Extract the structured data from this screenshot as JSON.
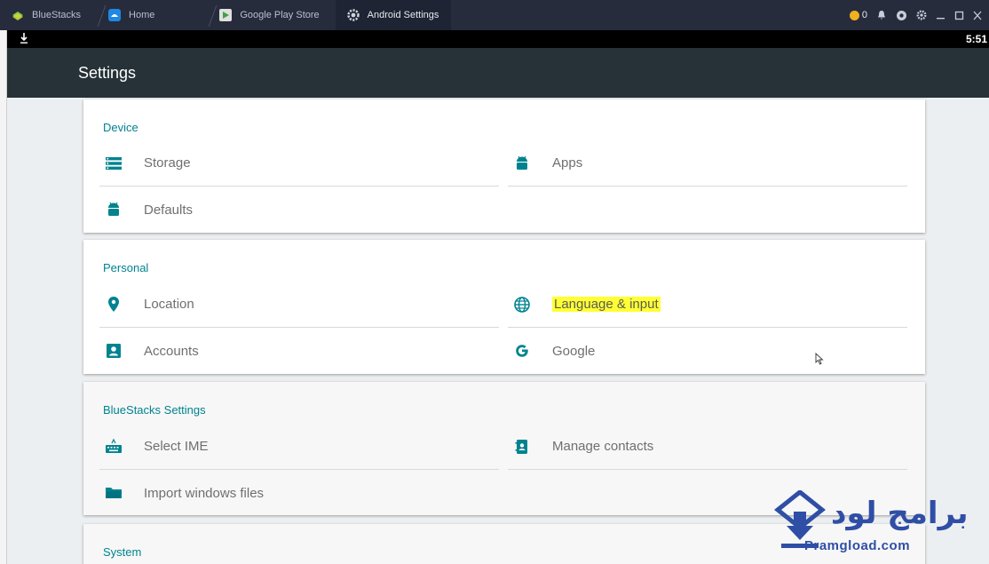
{
  "titlebar": {
    "tabs": [
      {
        "label": "BlueStacks",
        "icon": "bluestacks-logo-icon"
      },
      {
        "label": "Home",
        "icon": "home-icon"
      },
      {
        "label": "Google Play Store",
        "icon": "play-store-icon"
      },
      {
        "label": "Android Settings",
        "icon": "gear-icon"
      }
    ],
    "coins": "0"
  },
  "statusbar": {
    "time": "5:51"
  },
  "appbar": {
    "title": "Settings"
  },
  "sections": [
    {
      "title": "Device",
      "items": [
        {
          "label": "Storage",
          "icon": "storage-icon"
        },
        {
          "label": "Apps",
          "icon": "android-icon"
        },
        {
          "label": "Defaults",
          "icon": "android-icon"
        }
      ]
    },
    {
      "title": "Personal",
      "items": [
        {
          "label": "Location",
          "icon": "location-pin-icon"
        },
        {
          "label": "Language & input",
          "icon": "globe-icon"
        },
        {
          "label": "Accounts",
          "icon": "account-box-icon"
        },
        {
          "label": "Google",
          "icon": "google-g-icon"
        }
      ]
    },
    {
      "title": "BlueStacks Settings",
      "items": [
        {
          "label": "Select IME",
          "icon": "keyboard-icon"
        },
        {
          "label": "Manage contacts",
          "icon": "contacts-icon"
        },
        {
          "label": "Import windows files",
          "icon": "folder-icon"
        }
      ]
    },
    {
      "title": "System",
      "items": []
    }
  ],
  "watermark": {
    "arabic": "برامج لود",
    "latin": "Pramgload.com"
  },
  "colors": {
    "accent": "#00838f",
    "highlight": "#ffff33",
    "appbar": "#263238",
    "watermark": "#2f4ea5"
  }
}
